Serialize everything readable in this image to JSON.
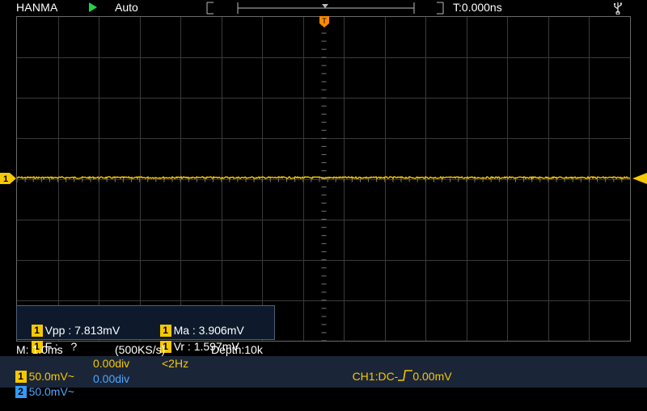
{
  "header": {
    "brand": "HANMA",
    "trigger_mode": "Auto",
    "time_offset": "T:0.000ns"
  },
  "markers": {
    "trigger_position": "T",
    "ch1_level": "1"
  },
  "measurements": [
    {
      "channel": "1",
      "label": "Vpp : 7.813mV"
    },
    {
      "channel": "1",
      "label": "Ma : 3.906mV"
    },
    {
      "channel": "1",
      "label": "F :    ?"
    },
    {
      "channel": "1",
      "label": "Vr : 1.597mV"
    }
  ],
  "timebase": {
    "label": "M: 1.0ms",
    "sample_rate": "(500KS/s)",
    "depth": "Depth:10k"
  },
  "ch1": {
    "badge": "1",
    "scale": "50.0mV~",
    "offset": "0.00div",
    "freq": "<2Hz",
    "trigger": "CH1:DC-",
    "trigger_level": "0.00mV",
    "color": "#f5c800"
  },
  "ch2": {
    "badge": "2",
    "scale": "50.0mV~",
    "offset": "0.00div",
    "color": "#2f9cff"
  },
  "icons": {
    "run": "play-icon",
    "usb": "usb-icon"
  }
}
